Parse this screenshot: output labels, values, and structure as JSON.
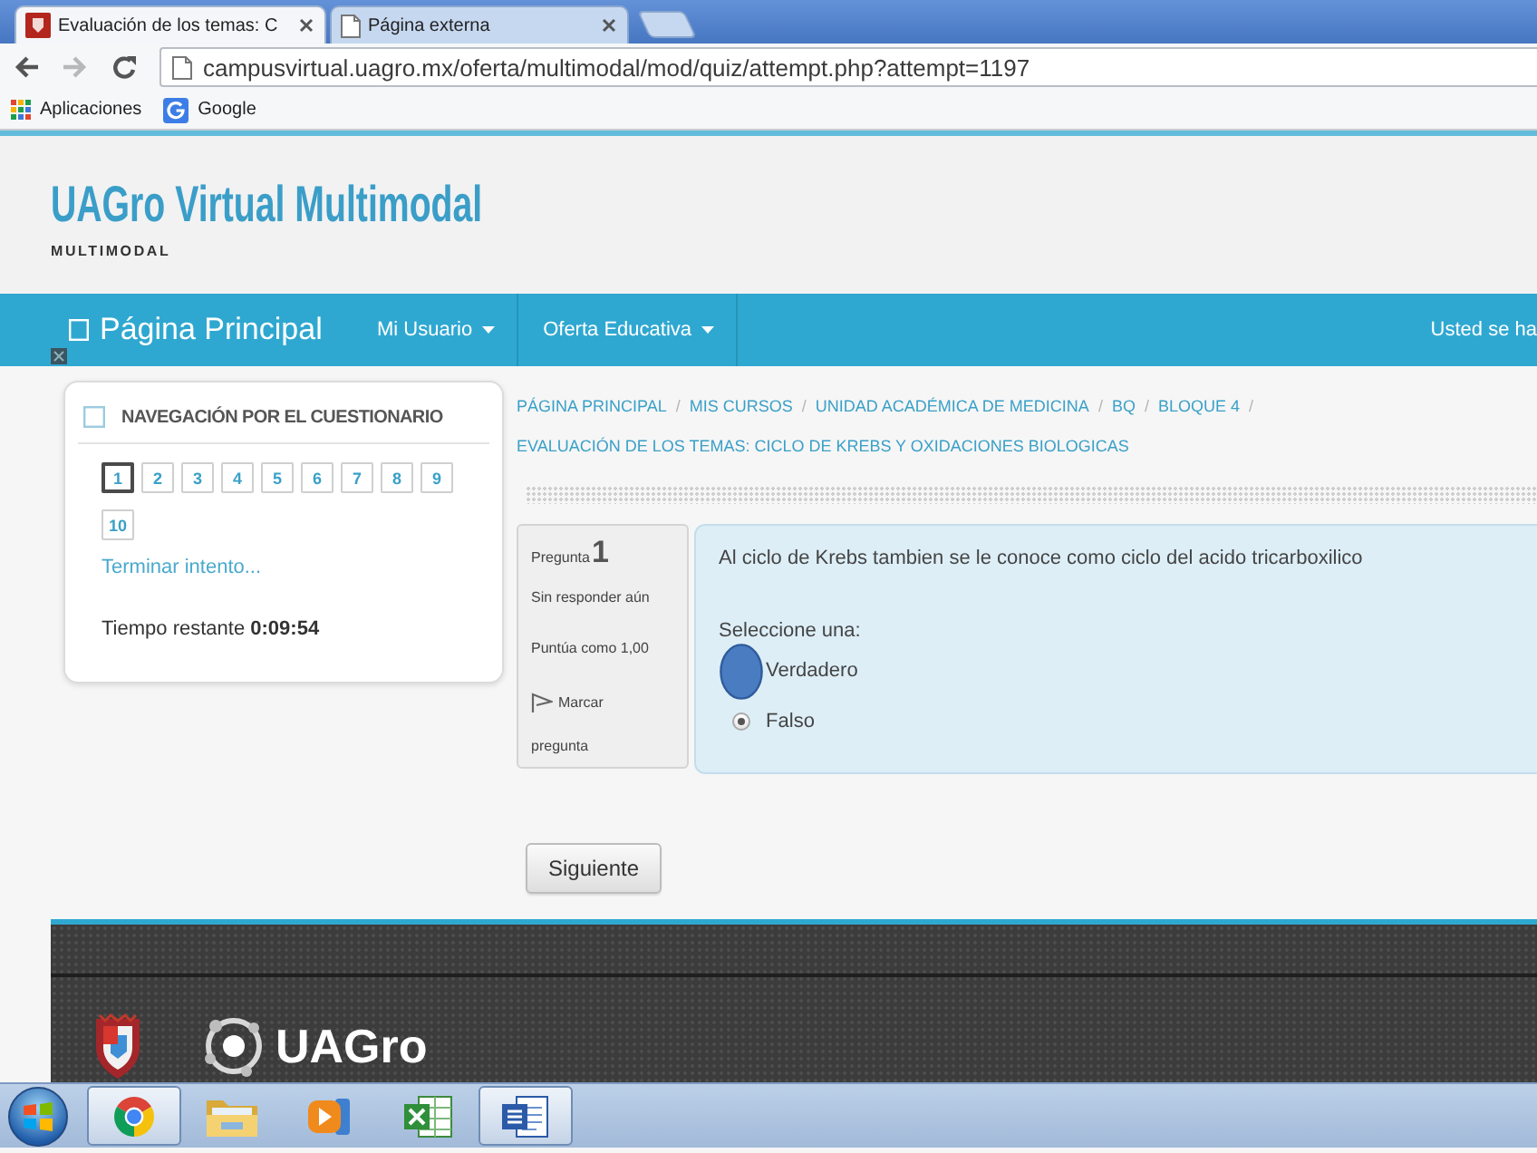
{
  "browser": {
    "tabs": [
      {
        "title": "Evaluación de los temas: C",
        "selected": true
      },
      {
        "title": "Página externa",
        "selected": false
      }
    ],
    "url": "campusvirtual.uagro.mx/oferta/multimodal/mod/quiz/attempt.php?attempt=1197",
    "bookmarks": [
      {
        "kind": "apps",
        "label": "Aplicaciones"
      },
      {
        "kind": "google",
        "label": "Google"
      }
    ]
  },
  "site": {
    "title": "UAGro Virtual Multimodal",
    "subtitle": "MULTIMODAL"
  },
  "navbar": {
    "brand": "Página Principal",
    "menus": [
      "Mi Usuario",
      "Oferta Educativa"
    ],
    "user_info": "Usted se ha"
  },
  "quiz_nav": {
    "title": "NAVEGACIÓN POR EL CUESTIONARIO",
    "questions": [
      {
        "label": "1",
        "selected": true
      },
      {
        "label": "2",
        "selected": false
      },
      {
        "label": "3",
        "selected": false
      },
      {
        "label": "4",
        "selected": false
      },
      {
        "label": "5",
        "selected": false
      },
      {
        "label": "6",
        "selected": false
      },
      {
        "label": "7",
        "selected": false
      },
      {
        "label": "8",
        "selected": false
      },
      {
        "label": "9",
        "selected": false
      },
      {
        "label": "10",
        "selected": false
      }
    ],
    "finish_link": "Terminar intento...",
    "time_left": "Tiempo restante **0:09:54**"
  },
  "breadcrumb": {
    "items": [
      "PÁGINA PRINCIPAL",
      "MIS CURSOS",
      "UNIDAD ACADÉMICA DE MEDICINA",
      "BQ",
      "BLOQUE 4",
      "EVALUACIÓN DE LOS TEMAS: CICLO DE KREBS Y OXIDACIONES BIOLOGICAS"
    ],
    "separator": "/"
  },
  "question_info": {
    "label": "Pregunta",
    "number": "1",
    "status": "Sin responder aún",
    "grade": "Puntúa como 1,00",
    "flag_label": "Marcar pregunta",
    "flagged": false
  },
  "question": {
    "text": "Al ciclo de Krebs tambien se le conoce como ciclo del acido tricarboxilico",
    "prompt": "Seleccione una:",
    "options": [
      {
        "label": "Verdadero",
        "selected": false,
        "marked": true
      },
      {
        "label": "Falso",
        "selected": true,
        "marked": false
      }
    ]
  },
  "next_button": "Siguiente",
  "footer": {
    "logo_text": "UAGro"
  },
  "taskbar": {
    "apps": [
      {
        "kind": "browser",
        "active": true
      },
      {
        "kind": "folder",
        "active": false
      },
      {
        "kind": "media",
        "active": false
      },
      {
        "kind": "spreadsheet",
        "active": false
      },
      {
        "kind": "document",
        "active": true
      }
    ]
  }
}
